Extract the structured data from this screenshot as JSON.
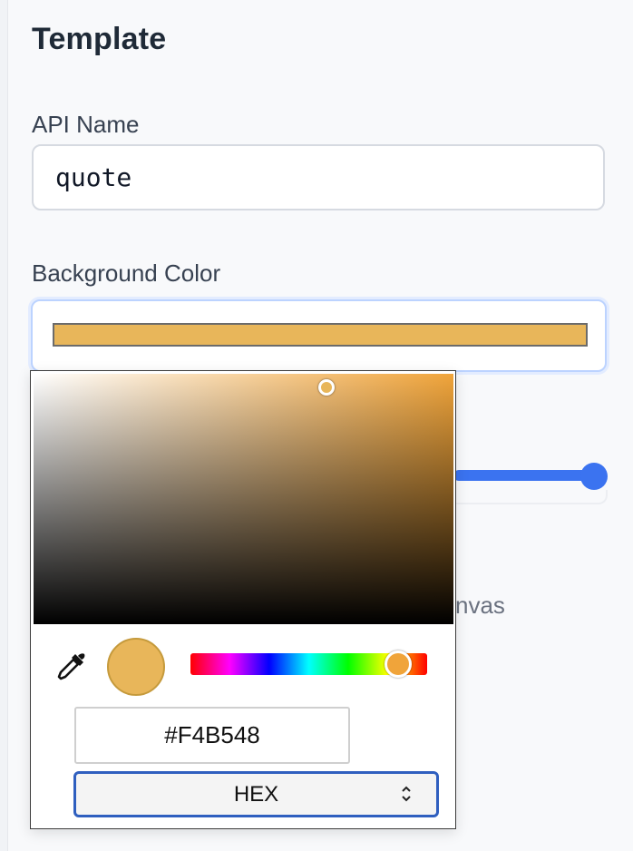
{
  "section": {
    "title": "Template"
  },
  "api_name": {
    "label": "API Name",
    "value": "quote"
  },
  "background_color": {
    "label": "Background Color",
    "swatch_color": "#E8B65A"
  },
  "occluded": {
    "partial_label": "nvas",
    "slider_color": "#3B73F0"
  },
  "color_picker": {
    "hue_handle_color": "#F0A43A",
    "preview_color": "#E8B65A",
    "hex_value": "#F4B548",
    "format_label": "HEX",
    "icons": {
      "eyedropper": "eyedropper-icon",
      "select_arrows": "chevron-up-down-icon"
    }
  }
}
